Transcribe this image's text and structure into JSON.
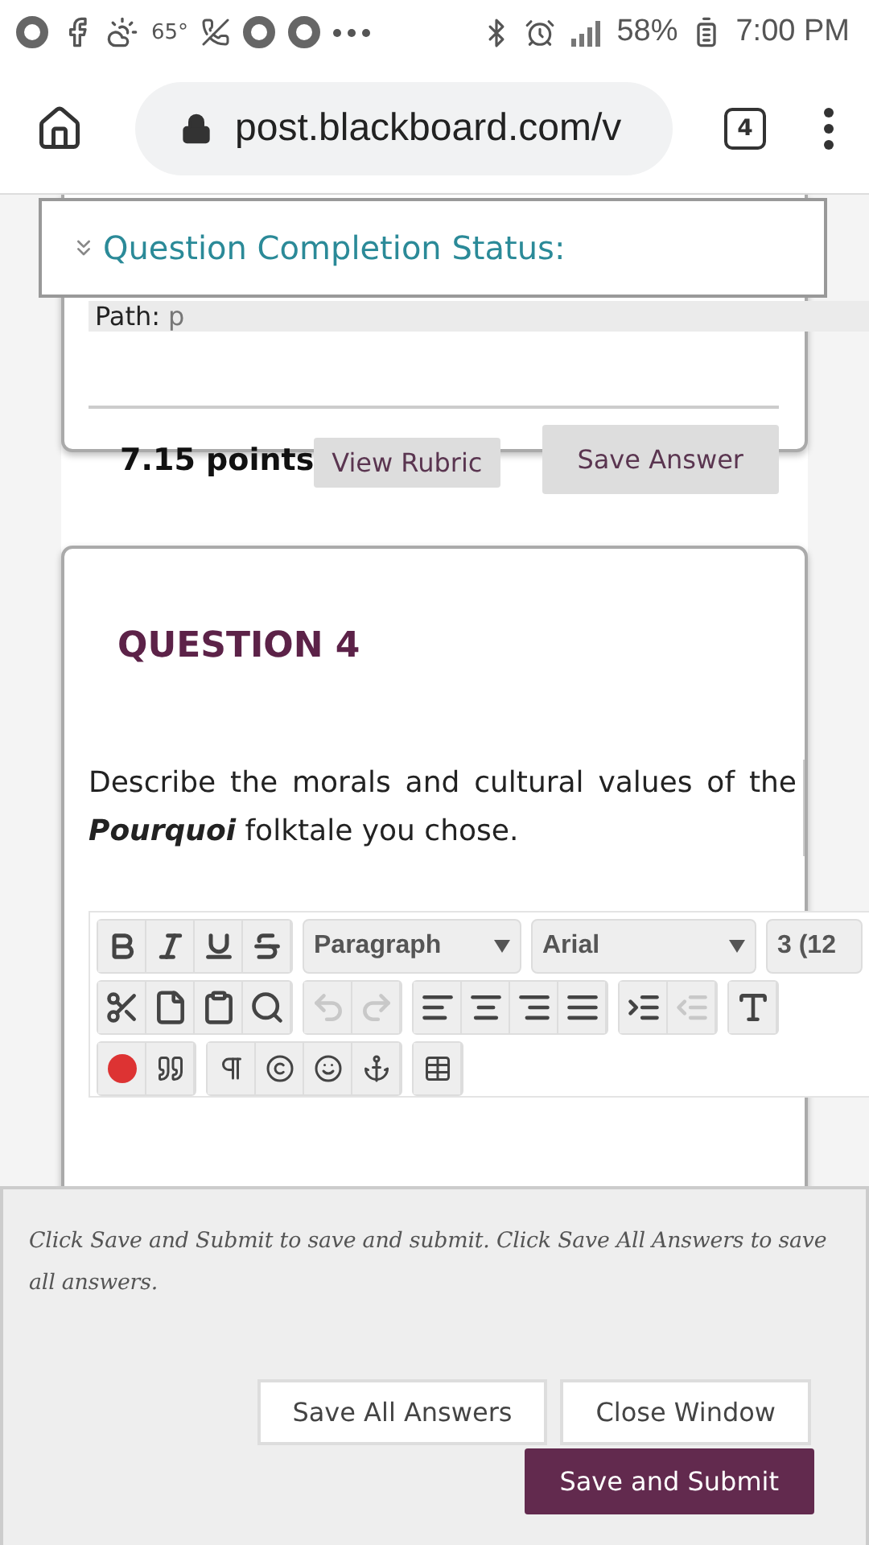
{
  "status_bar": {
    "temperature": "65°",
    "battery": "58%",
    "time": "7:00 PM"
  },
  "browser": {
    "url": "post.blackboard.com/v",
    "tab_count": "4"
  },
  "completion_status": {
    "label": "Question Completion Status:"
  },
  "previous_question": {
    "path_label": "Path:",
    "path_value": "p",
    "points": "7.15 points",
    "view_rubric": "View Rubric",
    "save_answer": "Save Answer"
  },
  "question": {
    "title": "QUESTION 4",
    "text": "Describe the morals and cultural values of the **Pourquoi** folktale you chose."
  },
  "editor": {
    "format_buttons": [
      {
        "kind": "bold"
      },
      {
        "kind": "italic"
      },
      {
        "kind": "underline"
      },
      {
        "kind": "strike"
      }
    ],
    "selects": [
      {
        "value": "Paragraph"
      },
      {
        "value": "Arial"
      },
      {
        "value": "3 (12"
      }
    ],
    "edit_buttons": [
      {
        "kind": "cut",
        "disabled": false
      },
      {
        "kind": "copy",
        "disabled": false
      },
      {
        "kind": "paste",
        "disabled": false
      },
      {
        "kind": "find",
        "disabled": false
      },
      {
        "kind": "undo",
        "disabled": true
      },
      {
        "kind": "redo",
        "disabled": true
      },
      {
        "kind": "align-left",
        "disabled": false
      },
      {
        "kind": "align-center",
        "disabled": false
      },
      {
        "kind": "align-right",
        "disabled": false
      },
      {
        "kind": "justify",
        "disabled": false
      },
      {
        "kind": "indent",
        "disabled": false
      },
      {
        "kind": "outdent",
        "disabled": true
      },
      {
        "kind": "text",
        "disabled": false
      }
    ]
  },
  "submit_panel": {
    "instructions": "Click Save and Submit to save and submit. Click Save All Answers to save all answers.",
    "save_all": "Save All Answers",
    "close_window": "Close Window",
    "save_submit": "Save and Submit"
  }
}
